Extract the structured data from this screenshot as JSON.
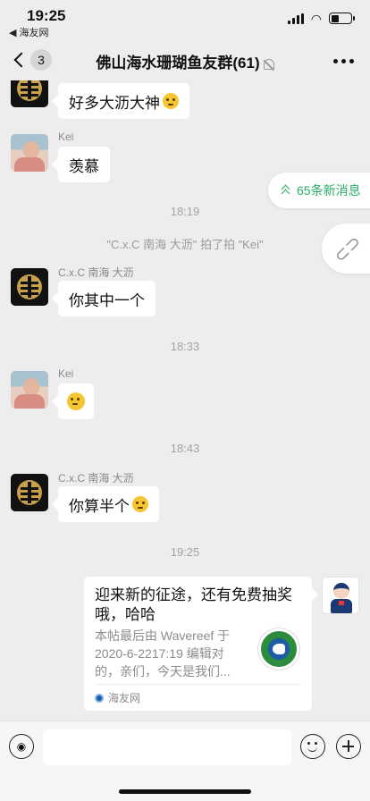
{
  "status_bar": {
    "time": "19:25",
    "back_app": "◀ 海友网",
    "icons": [
      "signal-icon",
      "wifi-icon",
      "battery-icon"
    ]
  },
  "nav": {
    "unread_count": "3",
    "title": "佛山海水珊瑚鱼友群(61)",
    "icons": [
      "back-chevron-icon",
      "mute-bell-icon",
      "more-icon"
    ]
  },
  "messages": [
    {
      "type": "text",
      "sender": "",
      "avatar": "gold-logo",
      "text": "好多大沥大神",
      "emoji": "thinking"
    },
    {
      "type": "text",
      "sender": "Kei",
      "avatar": "baby-photo",
      "text": "羡慕"
    },
    {
      "type": "time",
      "text": "18:19"
    },
    {
      "type": "system",
      "text": "\"C.x.C 南海 大沥\" 拍了拍 \"Kei\""
    },
    {
      "type": "text",
      "sender": "C.x.C 南海 大沥",
      "avatar": "gold-logo",
      "text": "你其中一个"
    },
    {
      "type": "time",
      "text": "18:33"
    },
    {
      "type": "emoji",
      "sender": "Kei",
      "avatar": "baby-photo",
      "emoji": "flushed"
    },
    {
      "type": "time",
      "text": "18:43"
    },
    {
      "type": "text",
      "sender": "C.x.C 南海 大沥",
      "avatar": "gold-logo",
      "text": "你算半个",
      "emoji": "thinking"
    },
    {
      "type": "time",
      "text": "19:25"
    }
  ],
  "link_card": {
    "title": "迎来新的征途，还有免费抽奖哦，哈哈",
    "desc": "本帖最后由 Wavereef 于 2020-6-2217:19 编辑对的，亲们，今天是我们...",
    "source": "海友网",
    "avatar": "police-cartoon"
  },
  "floating": {
    "new_messages": "65条新消息",
    "accent": "#2aae67"
  },
  "input_bar": {
    "placeholder": "",
    "icons": [
      "voice-icon",
      "emoji-icon",
      "plus-icon"
    ]
  }
}
